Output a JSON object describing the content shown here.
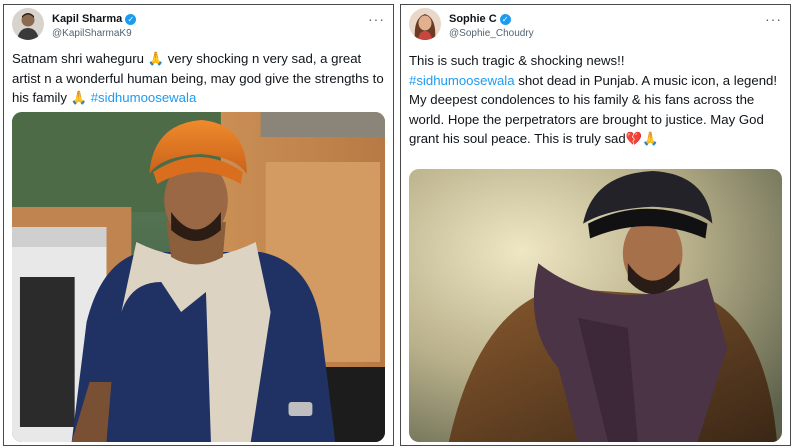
{
  "tweets": [
    {
      "author_name": "Kapil Sharma",
      "handle": "@KapilSharmaK9",
      "text_parts": [
        "Satnam shri waheguru 🙏 very shocking n very sad, a great artist n a wonderful human being, may god give the strengths to his family 🙏 ",
        "#sidhumoosewala"
      ],
      "media": "photo-man-orange-turban-beige-scarf"
    },
    {
      "author_name": "Sophie C",
      "handle": "@Sophie_Choudry",
      "text_parts": [
        "This is such tragic & shocking news!!",
        "#sidhumoosewala",
        " shot dead in Punjab. A music icon, a legend! My deepest condolences to his family & his fans across the world. Hope the perpetrators are brought to justice. May God grant his soul peace. This is truly sad💔🙏"
      ],
      "media": "photo-man-dark-turban-purple-scarf"
    }
  ],
  "icons": {
    "verified": "verified-badge-icon",
    "more": "more-options-icon"
  },
  "colors": {
    "hashtag": "#1d9bf0",
    "verified": "#1d9bf0",
    "secondary_text": "#536471"
  }
}
